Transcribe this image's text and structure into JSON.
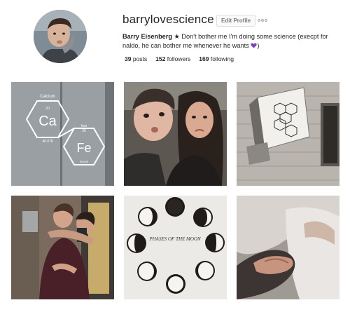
{
  "profile": {
    "username": "barrylovescience",
    "edit_label": "Edit Profile",
    "display_name": "Barry Eisenberg",
    "star": "★",
    "bio_text": "Don't bother me I'm doing some science (execpt for naldo, he can bother me whenever he wants",
    "bio_close": ")",
    "heart_color": "#7b3fc9"
  },
  "stats": {
    "posts_count": "39",
    "posts_label": "posts",
    "followers_count": "152",
    "followers_label": "followers",
    "following_count": "169",
    "following_label": "following"
  },
  "posts": {
    "post1": {
      "element1": "Calcium",
      "number1": "20",
      "symbol1": "Ca",
      "mass1": "40.078",
      "element2": "Iron",
      "number2": "26",
      "symbol2": "Fe",
      "mass2": "55.845"
    },
    "post5": {
      "caption": "PHASES OF THE MOON"
    }
  },
  "icons": [
    "more-options-icon",
    "purple-heart-icon"
  ]
}
